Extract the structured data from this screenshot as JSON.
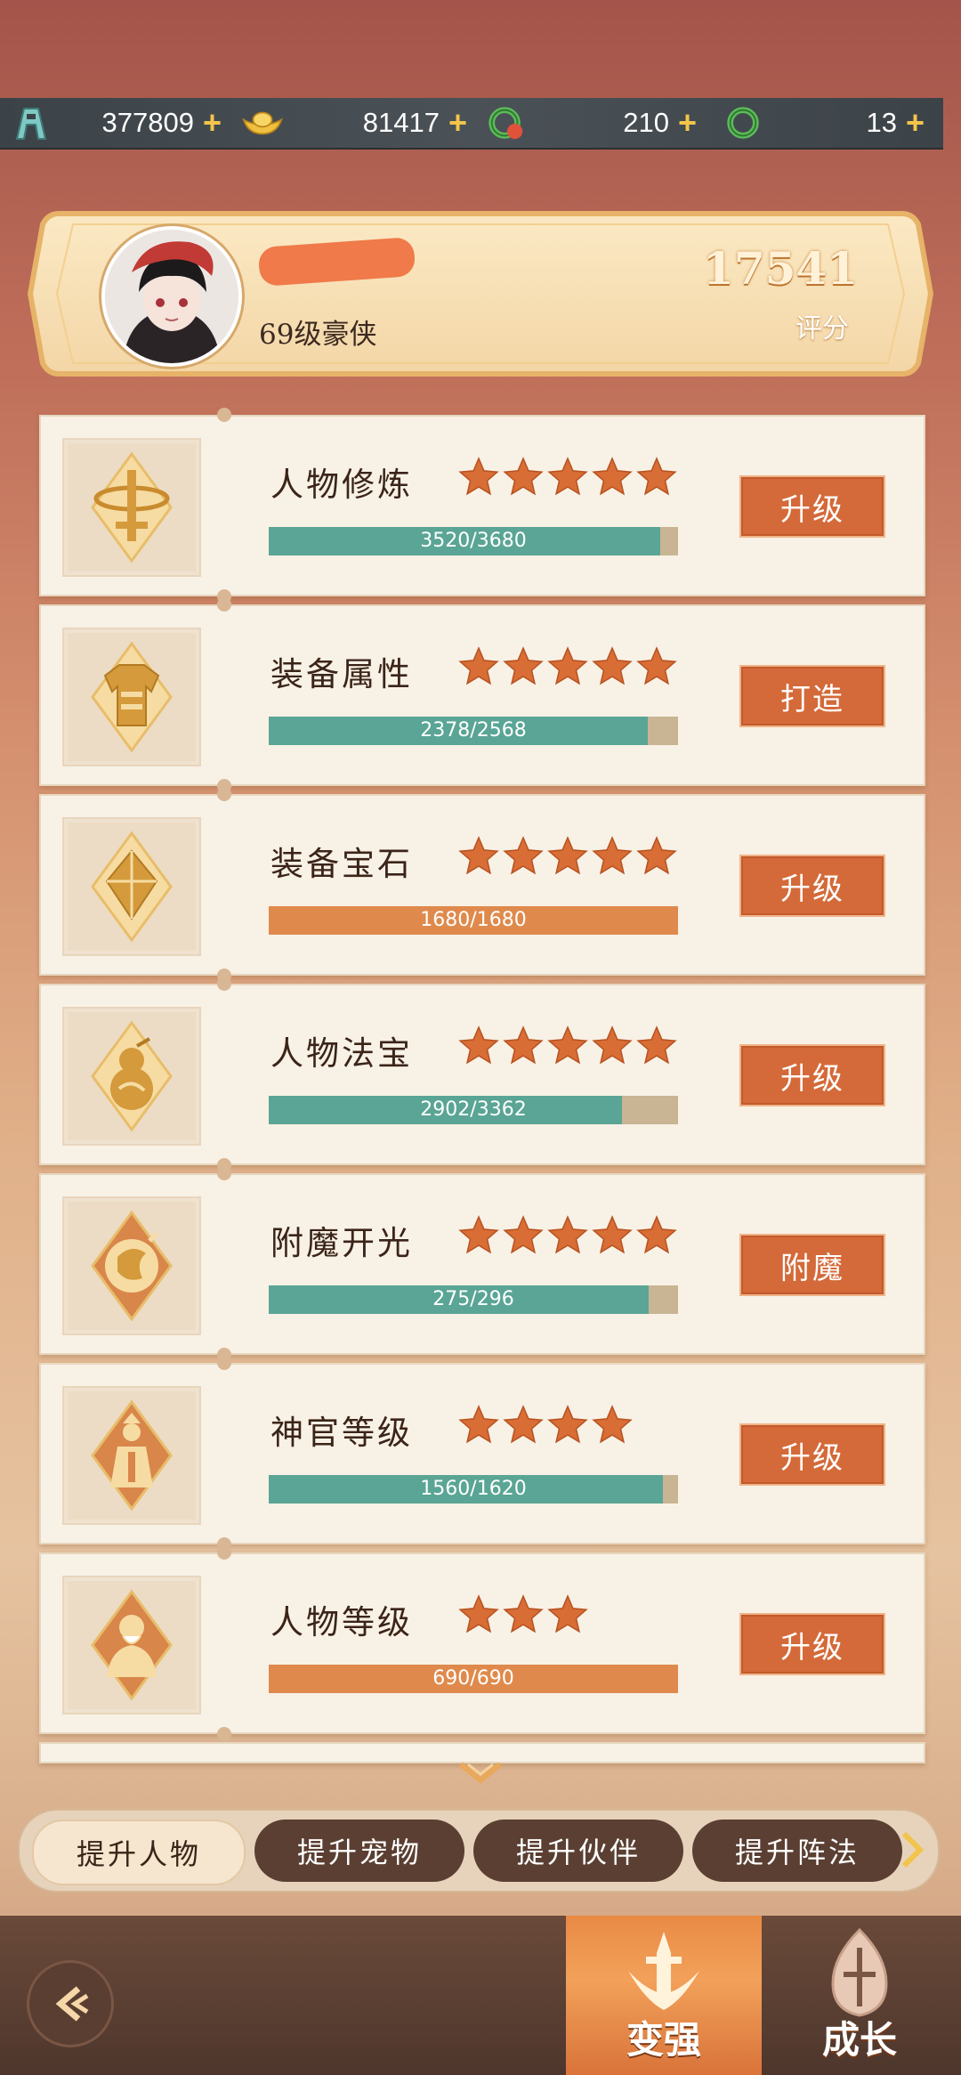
{
  "resources": [
    {
      "icon": "tower-icon",
      "value": "377809"
    },
    {
      "icon": "gold-ingot-icon",
      "value": "81417"
    },
    {
      "icon": "jade-dragon-badge-icon",
      "value": "210"
    },
    {
      "icon": "jade-dragon-ring-icon",
      "value": "13"
    }
  ],
  "profile": {
    "level_title": "69级豪侠",
    "score": "17541",
    "score_label": "评分"
  },
  "cards": [
    {
      "title": "人物修炼",
      "stars": 5,
      "progress_text": "3520/3680",
      "progress": 0.957,
      "color": "teal",
      "button": "升级",
      "icon": "sword-icon"
    },
    {
      "title": "装备属性",
      "stars": 5,
      "progress_text": "2378/2568",
      "progress": 0.926,
      "color": "teal",
      "button": "打造",
      "icon": "armor-icon"
    },
    {
      "title": "装备宝石",
      "stars": 5,
      "progress_text": "1680/1680",
      "progress": 1.0,
      "color": "orange",
      "button": "升级",
      "icon": "gem-icon"
    },
    {
      "title": "人物法宝",
      "stars": 5,
      "progress_text": "2902/3362",
      "progress": 0.863,
      "color": "teal",
      "button": "升级",
      "icon": "gourd-icon"
    },
    {
      "title": "附魔开光",
      "stars": 5,
      "progress_text": "275/296",
      "progress": 0.929,
      "color": "teal",
      "button": "附魔",
      "icon": "enchant-icon"
    },
    {
      "title": "神官等级",
      "stars": 4,
      "progress_text": "1560/1620",
      "progress": 0.963,
      "color": "teal",
      "button": "升级",
      "icon": "official-icon"
    },
    {
      "title": "人物等级",
      "stars": 3,
      "progress_text": "690/690",
      "progress": 1.0,
      "color": "orange",
      "button": "升级",
      "icon": "sage-icon"
    }
  ],
  "tabs": [
    {
      "label": "提升人物",
      "active": true
    },
    {
      "label": "提升宠物",
      "active": false
    },
    {
      "label": "提升伙伴",
      "active": false
    },
    {
      "label": "提升阵法",
      "active": false
    }
  ],
  "nav": {
    "active_label": "变强",
    "inactive_label": "成长"
  },
  "colors": {
    "accent_orange": "#d46a39",
    "progress_teal": "#5aa595",
    "progress_orange": "#df8a4c",
    "star": "#d86d36"
  }
}
